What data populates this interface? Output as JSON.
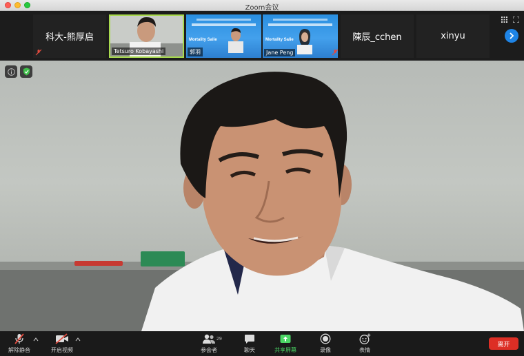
{
  "window": {
    "title": "Zoom会议"
  },
  "participants_strip": [
    {
      "name": "科大-熊厚启",
      "type": "namecard"
    },
    {
      "name": "Tetsuro Kobayashi",
      "type": "video",
      "active": true
    },
    {
      "name": "郭羽",
      "type": "slide",
      "slide_title": "Mortality Salie"
    },
    {
      "name": "Jane Peng",
      "type": "slide",
      "slide_title": "Mortality Salie"
    },
    {
      "name": "陳辰_cchen",
      "type": "namecard"
    },
    {
      "name": "xinyu",
      "type": "namecard"
    }
  ],
  "toolbar": {
    "unmute_label": "解除静音",
    "start_video_label": "开启视频",
    "participants_label": "参会者",
    "participants_count": "29",
    "chat_label": "聊天",
    "share_label": "共享屏幕",
    "record_label": "录像",
    "reactions_label": "表情",
    "leave_label": "离开"
  },
  "colors": {
    "share_green": "#4bd765",
    "leave_red": "#dd2e25",
    "next_blue": "#1e84e6",
    "active_border": "#a8d94e",
    "shield_green": "#3fbf4a"
  }
}
